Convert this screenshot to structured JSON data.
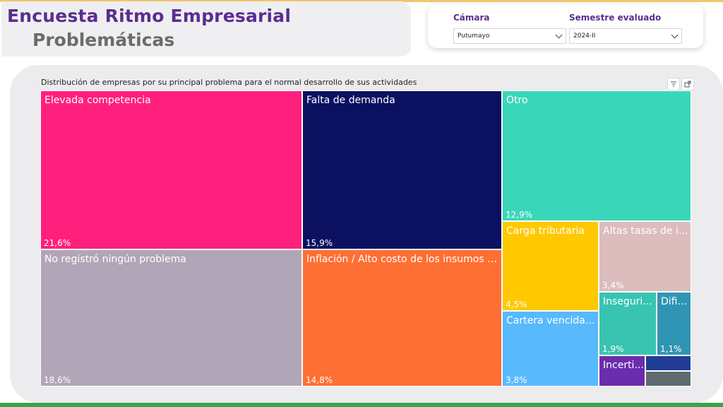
{
  "header": {
    "title": "Encuesta Ritmo Empresarial",
    "subtitle": "Problemáticas"
  },
  "filters": [
    {
      "label": "Cámara",
      "value": "Putumayo"
    },
    {
      "label": "Semestre evaluado",
      "value": "2024-II"
    }
  ],
  "visual_header": {
    "filter_icon": "filter-icon",
    "focus_icon": "focus-mode-icon"
  },
  "chart_data": {
    "type": "treemap",
    "title": "Distribución de empresas por su principal problema para el normal desarrollo de sus actividades",
    "unit": "%",
    "items": [
      {
        "label": "Elevada competencia",
        "value_label": "21,6%",
        "value": 21.6,
        "color": "#ff1f7c"
      },
      {
        "label": "No registró ningún problema",
        "value_label": "18,6%",
        "value": 18.6,
        "color": "#b0a6b7"
      },
      {
        "label": "Falta de demanda",
        "value_label": "15,9%",
        "value": 15.9,
        "color": "#0b1160"
      },
      {
        "label": "Inflación / Alto costo de los insumos ut...",
        "value_label": "14,8%",
        "value": 14.8,
        "color": "#fe6f33"
      },
      {
        "label": "Otro",
        "value_label": "12,9%",
        "value": 12.9,
        "color": "#3ad6ba"
      },
      {
        "label": "Carga tributaria",
        "value_label": "4,5%",
        "value": 4.5,
        "color": "#ffc800"
      },
      {
        "label": "Cartera vencida y...",
        "value_label": "3,8%",
        "value": 3.8,
        "color": "#58b9fd"
      },
      {
        "label": "Altas tasas de in...",
        "value_label": "3,4%",
        "value": 3.4,
        "color": "#dcbcbd"
      },
      {
        "label": "Inseguri...",
        "value_label": "1,9%",
        "value": 1.9,
        "color": "#38c4b0"
      },
      {
        "label": "Difi...",
        "value_label": "1,1%",
        "value": 1.1,
        "color": "#3095b4"
      },
      {
        "label": "Incerti...",
        "value_label": "",
        "value": 0.7,
        "color": "#6a2dad"
      },
      {
        "label": "",
        "value_label": "",
        "value": 0.4,
        "color": "#213d96"
      },
      {
        "label": "",
        "value_label": "",
        "value": 0.3,
        "color": "#5f6b6e"
      }
    ]
  }
}
